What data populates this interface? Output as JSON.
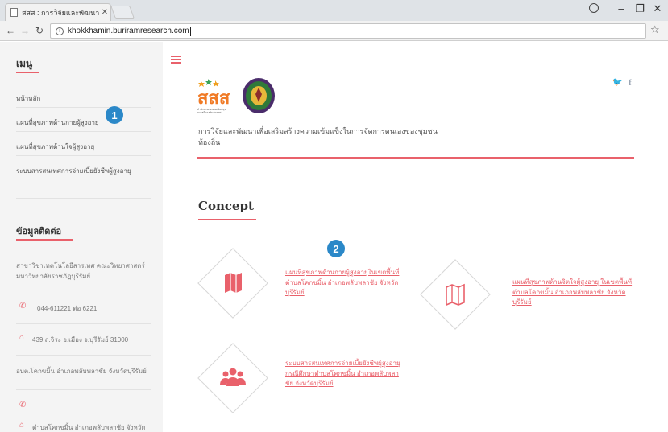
{
  "browser": {
    "tab_title": "สสส : การวิจัยและพัฒนาเพื่อ",
    "url": "khokkhamin.buriramresearch.com"
  },
  "sidebar": {
    "menu_heading": "เมนู",
    "menu_items": [
      "หน้าหลัก",
      "แผนที่สุขภาพด้านกายผู้สูงอายุ",
      "แผนที่สุขภาพด้านใจผู้สูงอายุ",
      "ระบบสารสนเทศการจ่ายเบี้ยยังชีพผู้สูงอายุ"
    ],
    "contact_heading": "ข้อมูลติดต่อ",
    "contact_org": "สาขาวิชาเทคโนโลยีสารเทศ คณะวิทยาศาสตร์ มหาวิทยาลัยราชภัฏบุรีรัมย์",
    "phone": "044-611221 ต่อ 6221",
    "address": "439 ถ.จิระ อ.เมือง จ.บุรีรัมย์ 31000",
    "local_org": "อบต.โคกขมิ้น อำเภอพลับพลาชัย จังหวัดบุรีรัมย์",
    "local_address": "ตำบลโคกขมิ้น อำเภอพลับพลาชัย จังหวัด"
  },
  "badges": {
    "one": "1",
    "two": "2"
  },
  "main": {
    "logo_text": "สสส",
    "logo_subtext": "สำนักงานกองทุนสนับสนุนการสร้างเสริมสุขภาพ",
    "description": "การวิจัยและพัฒนาเพื่อเสริมสร้างความเข้มแข็งในการจัดการตนเองของชุมชนท้องถิ่น",
    "concept_title": "Concept",
    "features": [
      {
        "icon": "map-icon",
        "link": "แผนที่สุขภาพด้านกายผู้สูงอายุในเขตพื้นที่ตำบลโคกขมิ้น อำเภอพลับพลาชัย จังหวัดบุรีรัมย์"
      },
      {
        "icon": "folded-map-icon",
        "link": "แผนที่สุขภาพด้านจิตใจผู้สูงอายุ ในเขตพื้นที่ตำบลโคกขมิ้น อำเภอพลับพลาชัย จังหวัดบุรีรัมย์"
      },
      {
        "icon": "users-group-icon",
        "link": "ระบบสารสนเทศการจ่ายเบี้ยยังชีพผู้สูงอายุ กรณีศึกษาตำบลโคกขมิ้น อำเภอพลับพลาชัย จังหวัดบุรีรัมย์"
      }
    ]
  },
  "colors": {
    "accent": "#e9616b",
    "badge": "#2b88c8",
    "sidebar_bg": "#f4f4f4"
  }
}
